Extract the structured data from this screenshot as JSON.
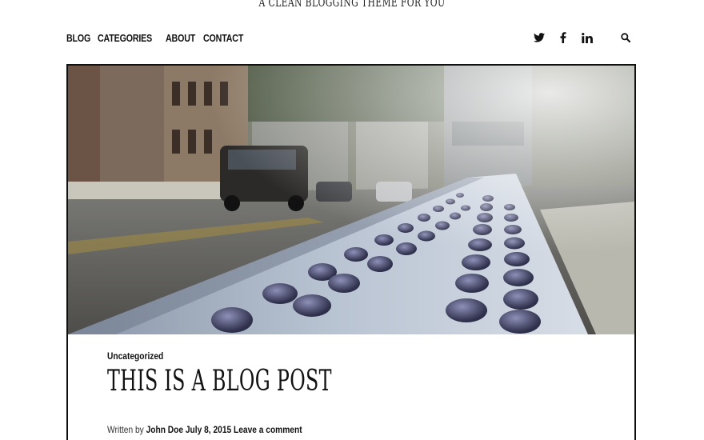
{
  "site": {
    "tagline": "A clean blogging theme for you"
  },
  "nav": {
    "items": [
      {
        "label": "BLOG"
      },
      {
        "label": "CATEGORIES"
      },
      {
        "label": "ABOUT"
      },
      {
        "label": "CONTACT"
      }
    ]
  },
  "social": {
    "icons": [
      "twitter-icon",
      "facebook-icon",
      "linkedin-icon",
      "search-icon"
    ]
  },
  "post": {
    "category": "Uncategorized",
    "title": "This is a blog post",
    "meta_prefix": "Written by",
    "author": "John Doe",
    "date": "July 8, 2015",
    "comment_link": "Leave a comment"
  },
  "colors": {
    "text": "#111111",
    "border": "#111111",
    "background": "#ffffff"
  }
}
